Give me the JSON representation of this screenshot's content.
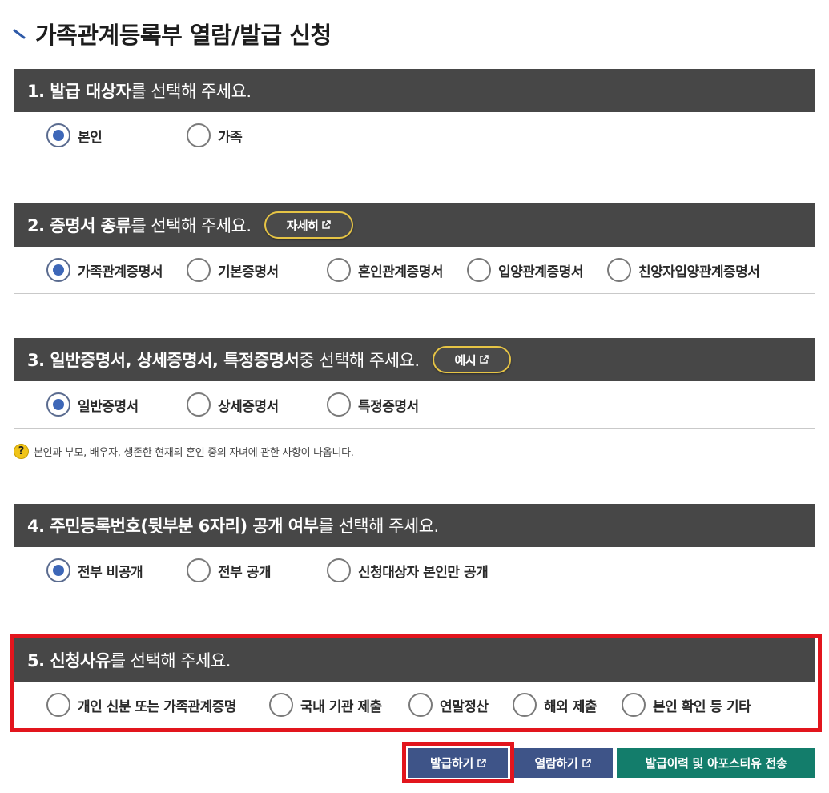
{
  "page": {
    "title": "가족관계등록부 열람/발급 신청"
  },
  "sections": [
    {
      "head_strong": "1. 발급 대상자",
      "head_normal": "를 선택해 주세요.",
      "options": [
        {
          "label": "본인",
          "checked": true
        },
        {
          "label": "가족",
          "checked": false
        }
      ]
    },
    {
      "head_strong": "2. 증명서 종류",
      "head_normal": "를 선택해 주세요.",
      "button_label": "자세히",
      "options": [
        {
          "label": "가족관계증명서",
          "checked": true
        },
        {
          "label": "기본증명서",
          "checked": false
        },
        {
          "label": "혼인관계증명서",
          "checked": false
        },
        {
          "label": "입양관계증명서",
          "checked": false
        },
        {
          "label": "친양자입양관계증명서",
          "checked": false
        }
      ]
    },
    {
      "head_strong": "3. 일반증명서, 상세증명서, 특정증명서",
      "head_normal": " 중 선택해 주세요.",
      "button_label": "예시",
      "options": [
        {
          "label": "일반증명서",
          "checked": true
        },
        {
          "label": "상세증명서",
          "checked": false
        },
        {
          "label": "특정증명서",
          "checked": false
        }
      ]
    },
    {
      "head_strong": "4. 주민등록번호(뒷부분 6자리) 공개 여부",
      "head_normal": "를 선택해 주세요.",
      "options": [
        {
          "label": "전부 비공개",
          "checked": true
        },
        {
          "label": "전부 공개",
          "checked": false
        },
        {
          "label": "신청대상자 본인만 공개",
          "checked": false
        }
      ]
    },
    {
      "head_strong": "5. 신청사유",
      "head_normal": "를 선택해 주세요.",
      "options": [
        {
          "label": "개인 신분 또는 가족관계증명",
          "checked": false
        },
        {
          "label": "국내 기관 제출",
          "checked": false
        },
        {
          "label": "연말정산",
          "checked": false
        },
        {
          "label": "해외 제출",
          "checked": false
        },
        {
          "label": "본인 확인 등 기타",
          "checked": false
        }
      ]
    }
  ],
  "help": {
    "icon": "?",
    "text": "본인과 부모, 배우자, 생존한 현재의 혼인 중의 자녀에 관한 사항이 나옵니다."
  },
  "actions": {
    "issue_label": "발급하기",
    "view_label": "열람하기",
    "history_label": "발급이력 및 아포스티유 전송"
  },
  "colors": {
    "section_header": "#474747",
    "radio_checked": "#3d67b8",
    "pill_border": "#e6c445",
    "primary_button": "#3e5488",
    "history_button": "#137d6b",
    "highlight": "#e2151d"
  }
}
